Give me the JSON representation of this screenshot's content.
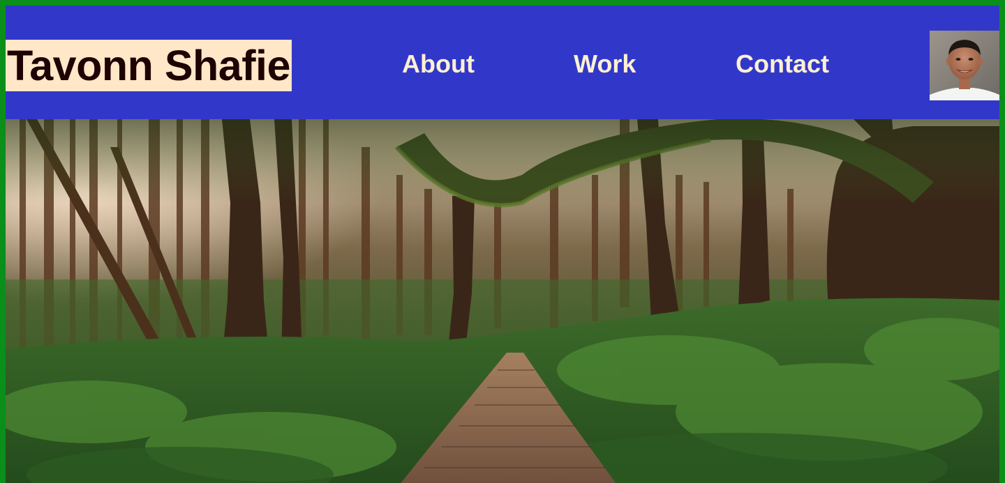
{
  "site": {
    "name": "Tavonn Shafie"
  },
  "nav": {
    "items": [
      {
        "label": "About"
      },
      {
        "label": "Work"
      },
      {
        "label": "Contact"
      }
    ]
  },
  "colors": {
    "frame_border": "#0a8f1a",
    "header_background": "#3138c9",
    "logo_background": "#ffe7c8",
    "logo_text": "#1e0303",
    "nav_text": "#fff0d2"
  },
  "icons": {
    "avatar": "profile-photo",
    "hero": "forest-path-photo"
  }
}
